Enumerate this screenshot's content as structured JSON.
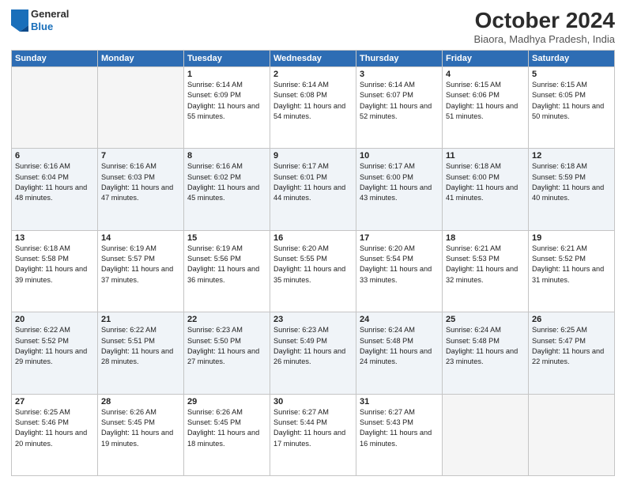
{
  "header": {
    "logo": {
      "general": "General",
      "blue": "Blue"
    },
    "title": "October 2024",
    "location": "Biaora, Madhya Pradesh, India"
  },
  "weekdays": [
    "Sunday",
    "Monday",
    "Tuesday",
    "Wednesday",
    "Thursday",
    "Friday",
    "Saturday"
  ],
  "weeks": [
    [
      null,
      null,
      {
        "day": 1,
        "sunrise": "6:14 AM",
        "sunset": "6:09 PM",
        "daylight": "11 hours and 55 minutes."
      },
      {
        "day": 2,
        "sunrise": "6:14 AM",
        "sunset": "6:08 PM",
        "daylight": "11 hours and 54 minutes."
      },
      {
        "day": 3,
        "sunrise": "6:14 AM",
        "sunset": "6:07 PM",
        "daylight": "11 hours and 52 minutes."
      },
      {
        "day": 4,
        "sunrise": "6:15 AM",
        "sunset": "6:06 PM",
        "daylight": "11 hours and 51 minutes."
      },
      {
        "day": 5,
        "sunrise": "6:15 AM",
        "sunset": "6:05 PM",
        "daylight": "11 hours and 50 minutes."
      }
    ],
    [
      {
        "day": 6,
        "sunrise": "6:16 AM",
        "sunset": "6:04 PM",
        "daylight": "11 hours and 48 minutes."
      },
      {
        "day": 7,
        "sunrise": "6:16 AM",
        "sunset": "6:03 PM",
        "daylight": "11 hours and 47 minutes."
      },
      {
        "day": 8,
        "sunrise": "6:16 AM",
        "sunset": "6:02 PM",
        "daylight": "11 hours and 45 minutes."
      },
      {
        "day": 9,
        "sunrise": "6:17 AM",
        "sunset": "6:01 PM",
        "daylight": "11 hours and 44 minutes."
      },
      {
        "day": 10,
        "sunrise": "6:17 AM",
        "sunset": "6:00 PM",
        "daylight": "11 hours and 43 minutes."
      },
      {
        "day": 11,
        "sunrise": "6:18 AM",
        "sunset": "6:00 PM",
        "daylight": "11 hours and 41 minutes."
      },
      {
        "day": 12,
        "sunrise": "6:18 AM",
        "sunset": "5:59 PM",
        "daylight": "11 hours and 40 minutes."
      }
    ],
    [
      {
        "day": 13,
        "sunrise": "6:18 AM",
        "sunset": "5:58 PM",
        "daylight": "11 hours and 39 minutes."
      },
      {
        "day": 14,
        "sunrise": "6:19 AM",
        "sunset": "5:57 PM",
        "daylight": "11 hours and 37 minutes."
      },
      {
        "day": 15,
        "sunrise": "6:19 AM",
        "sunset": "5:56 PM",
        "daylight": "11 hours and 36 minutes."
      },
      {
        "day": 16,
        "sunrise": "6:20 AM",
        "sunset": "5:55 PM",
        "daylight": "11 hours and 35 minutes."
      },
      {
        "day": 17,
        "sunrise": "6:20 AM",
        "sunset": "5:54 PM",
        "daylight": "11 hours and 33 minutes."
      },
      {
        "day": 18,
        "sunrise": "6:21 AM",
        "sunset": "5:53 PM",
        "daylight": "11 hours and 32 minutes."
      },
      {
        "day": 19,
        "sunrise": "6:21 AM",
        "sunset": "5:52 PM",
        "daylight": "11 hours and 31 minutes."
      }
    ],
    [
      {
        "day": 20,
        "sunrise": "6:22 AM",
        "sunset": "5:52 PM",
        "daylight": "11 hours and 29 minutes."
      },
      {
        "day": 21,
        "sunrise": "6:22 AM",
        "sunset": "5:51 PM",
        "daylight": "11 hours and 28 minutes."
      },
      {
        "day": 22,
        "sunrise": "6:23 AM",
        "sunset": "5:50 PM",
        "daylight": "11 hours and 27 minutes."
      },
      {
        "day": 23,
        "sunrise": "6:23 AM",
        "sunset": "5:49 PM",
        "daylight": "11 hours and 26 minutes."
      },
      {
        "day": 24,
        "sunrise": "6:24 AM",
        "sunset": "5:48 PM",
        "daylight": "11 hours and 24 minutes."
      },
      {
        "day": 25,
        "sunrise": "6:24 AM",
        "sunset": "5:48 PM",
        "daylight": "11 hours and 23 minutes."
      },
      {
        "day": 26,
        "sunrise": "6:25 AM",
        "sunset": "5:47 PM",
        "daylight": "11 hours and 22 minutes."
      }
    ],
    [
      {
        "day": 27,
        "sunrise": "6:25 AM",
        "sunset": "5:46 PM",
        "daylight": "11 hours and 20 minutes."
      },
      {
        "day": 28,
        "sunrise": "6:26 AM",
        "sunset": "5:45 PM",
        "daylight": "11 hours and 19 minutes."
      },
      {
        "day": 29,
        "sunrise": "6:26 AM",
        "sunset": "5:45 PM",
        "daylight": "11 hours and 18 minutes."
      },
      {
        "day": 30,
        "sunrise": "6:27 AM",
        "sunset": "5:44 PM",
        "daylight": "11 hours and 17 minutes."
      },
      {
        "day": 31,
        "sunrise": "6:27 AM",
        "sunset": "5:43 PM",
        "daylight": "11 hours and 16 minutes."
      },
      null,
      null
    ]
  ]
}
